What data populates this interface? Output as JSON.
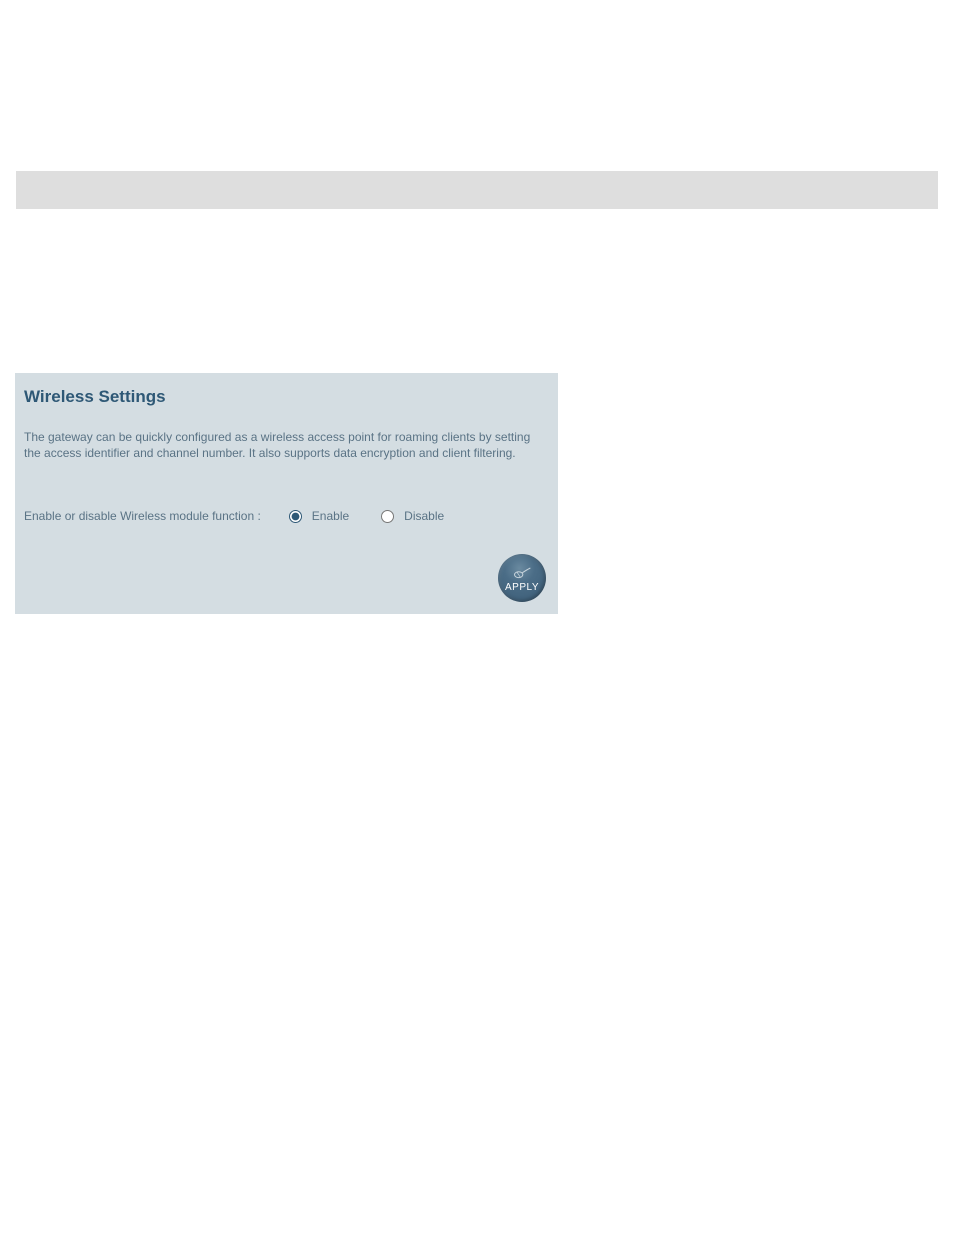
{
  "panel": {
    "title": "Wireless Settings",
    "description": "The gateway can be quickly configured as a wireless access point for roaming clients by setting the access identifier and channel number. It also supports data encryption and client filtering.",
    "radio_label": "Enable or disable Wireless module function :",
    "options": {
      "enable": "Enable",
      "disable": "Disable"
    },
    "apply_label": "APPLY",
    "selected": "enable"
  }
}
